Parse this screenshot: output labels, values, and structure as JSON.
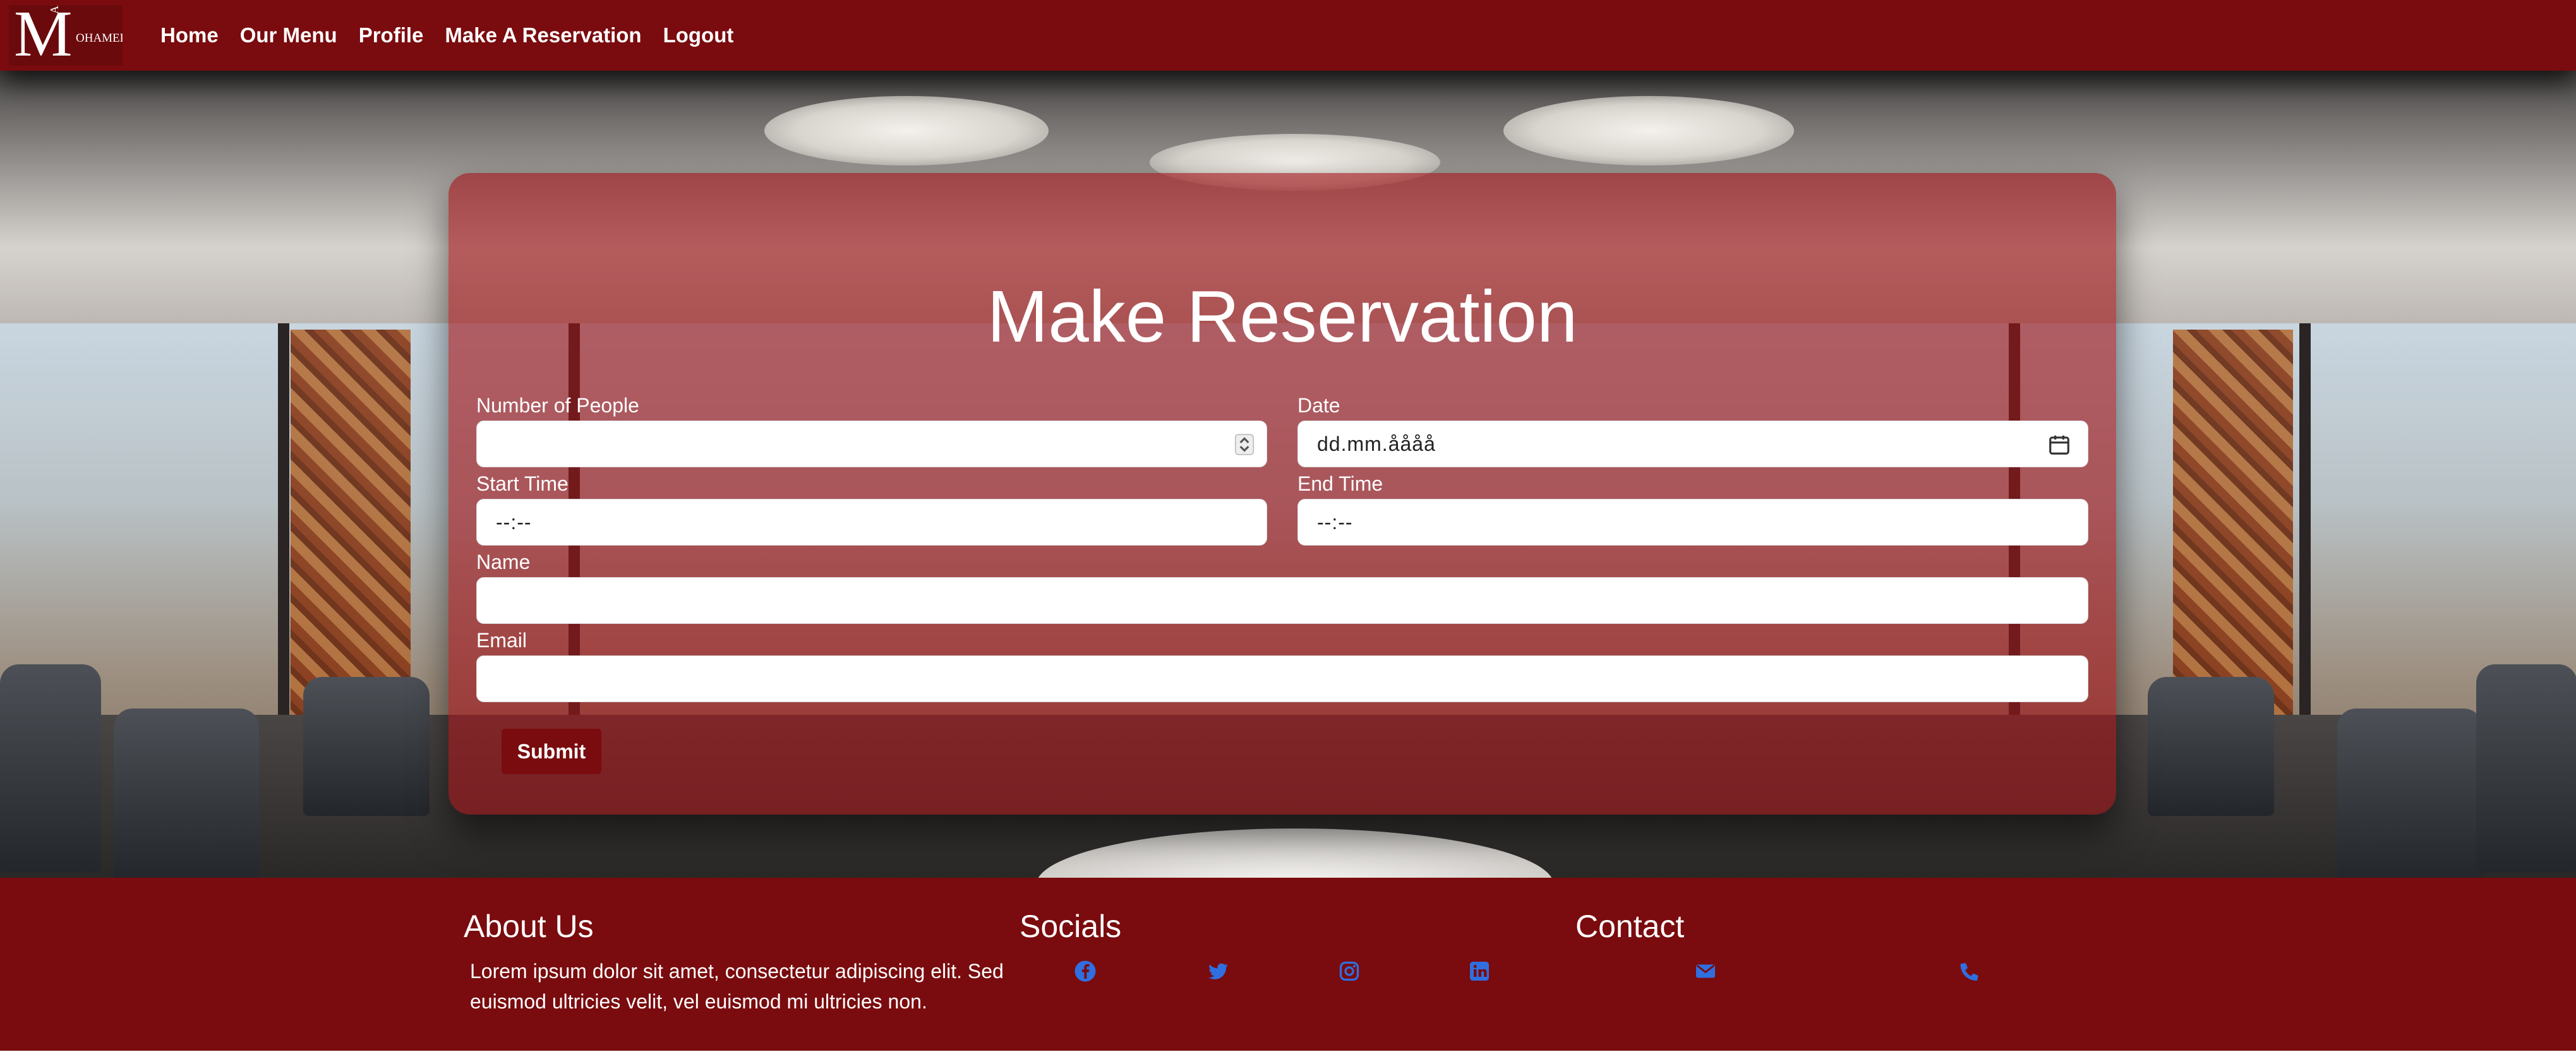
{
  "brand": {
    "logo_letter": "M",
    "logo_side": "ALI",
    "logo_text": "OHAMED"
  },
  "nav": {
    "items": [
      {
        "label": "Home"
      },
      {
        "label": "Our Menu"
      },
      {
        "label": "Profile"
      },
      {
        "label": "Make A Reservation"
      },
      {
        "label": "Logout"
      }
    ]
  },
  "reservation": {
    "title": "Make Reservation",
    "people": {
      "label": "Number of People",
      "value": ""
    },
    "date": {
      "label": "Date",
      "placeholder": "dd.mm.åååå",
      "icon": "calendar-icon"
    },
    "start_time": {
      "label": "Start Time",
      "placeholder": "--:--"
    },
    "end_time": {
      "label": "End Time",
      "placeholder": "--:--"
    },
    "name": {
      "label": "Name",
      "value": ""
    },
    "email": {
      "label": "Email",
      "value": ""
    },
    "submit_label": "Submit"
  },
  "footer": {
    "about": {
      "heading": "About Us",
      "text": "Lorem ipsum dolor sit amet, consectetur adipiscing elit. Sed euismod ultricies velit, vel euismod mi ultricies non."
    },
    "socials": {
      "heading": "Socials",
      "icons": [
        "facebook-icon",
        "twitter-icon",
        "instagram-icon",
        "linkedin-icon"
      ]
    },
    "contact": {
      "heading": "Contact",
      "icons": [
        "envelope-icon",
        "phone-icon"
      ]
    }
  },
  "colors": {
    "primary": "#7a0b0e",
    "card_overlay": "#a01418",
    "social_icon": "#2f6fe0",
    "text_light": "#ffffff"
  }
}
